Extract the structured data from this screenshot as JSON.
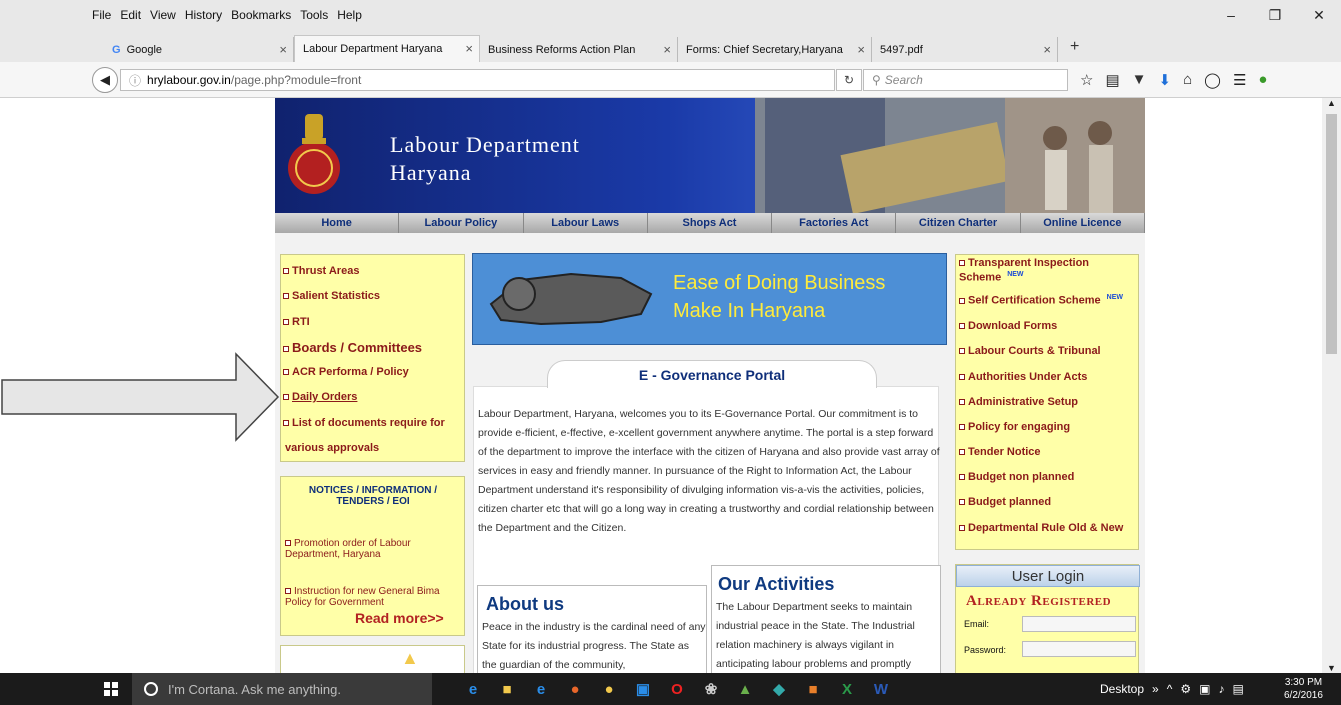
{
  "browser": {
    "menu": [
      "File",
      "Edit",
      "View",
      "History",
      "Bookmarks",
      "Tools",
      "Help"
    ],
    "tabs": [
      {
        "label": "Google",
        "active": false
      },
      {
        "label": "Labour Department Haryana",
        "active": true
      },
      {
        "label": "Business Reforms Action Plan",
        "active": false
      },
      {
        "label": "Forms: Chief Secretary,Haryana",
        "active": false
      },
      {
        "label": "5497.pdf",
        "active": false
      }
    ],
    "url_host": "hrylabour.gov.in",
    "url_path": "/page.php?module=front",
    "search_placeholder": "Search",
    "window_controls": [
      "minimize-icon",
      "restore-icon",
      "close-icon"
    ]
  },
  "site": {
    "title_line1": "Labour Department",
    "title_line2": "Haryana",
    "nav": [
      "Home",
      "Labour Policy",
      "Labour Laws",
      "Shops Act",
      "Factories Act",
      "Citizen Charter",
      "Online Licence"
    ],
    "left_links": [
      "Thrust Areas",
      "Salient Statistics",
      "RTI",
      "Boards / Committees",
      "ACR Performa / Policy",
      "Daily Orders",
      "List of documents require for",
      "various approvals"
    ],
    "notices": {
      "heading": "NOTICES / INFORMATION / TENDERS / EOI",
      "items": [
        "Promotion order of Labour Department, Haryana",
        "Instruction for new General Bima Policy for Government"
      ],
      "read_more": "Read more>>"
    },
    "banner_mih": {
      "line1": "Ease of Doing Business",
      "line2": "Make In Haryana"
    },
    "egov_title": "E - Governance Portal",
    "egov_text": "Labour Department, Haryana, welcomes you to its E-Governance Portal. Our commitment is to provide e-fficient, e-ffective, e-xcellent government anywhere anytime. The portal is a step forward of the department to improve the interface with the citizen of Haryana and also provide vast array of services in easy and friendly manner. In pursuance of the Right to Information Act, the Labour Department understand it's responsibility of divulging information vis-a-vis the activities, policies, citizen charter etc that will go a long way in creating a trustworthy and cordial relationship between the Department and the Citizen.",
    "about": {
      "title": "About us",
      "text": "Peace in the industry is the cardinal need of any State for its industrial progress. The State as the guardian of the community,"
    },
    "activities": {
      "title": "Our Activities",
      "text": "The Labour Department seeks to maintain industrial peace in the State. The Industrial relation machinery is always vigilant in anticipating labour problems and promptly"
    },
    "right_links": [
      {
        "label": "Transparent Inspection Scheme",
        "new": "NEW"
      },
      {
        "label": "Self Certification Scheme",
        "new": "NEW"
      },
      {
        "label": "Download Forms"
      },
      {
        "label": "Labour Courts & Tribunal"
      },
      {
        "label": "Authorities Under Acts"
      },
      {
        "label": "Administrative Setup"
      },
      {
        "label": "Policy for engaging"
      },
      {
        "label": "Tender Notice"
      },
      {
        "label": "Budget non planned"
      },
      {
        "label": "Budget planned"
      },
      {
        "label": "Departmental Rule Old & New"
      }
    ],
    "login": {
      "header": "User Login",
      "subtitle": "Already Registered",
      "email_label": "Email:",
      "password_label": "Password:"
    }
  },
  "taskbar": {
    "search_placeholder": "I'm Cortana. Ask me anything.",
    "desktop_label": "Desktop",
    "time": "3:30 PM",
    "date": "6/2/2016"
  }
}
